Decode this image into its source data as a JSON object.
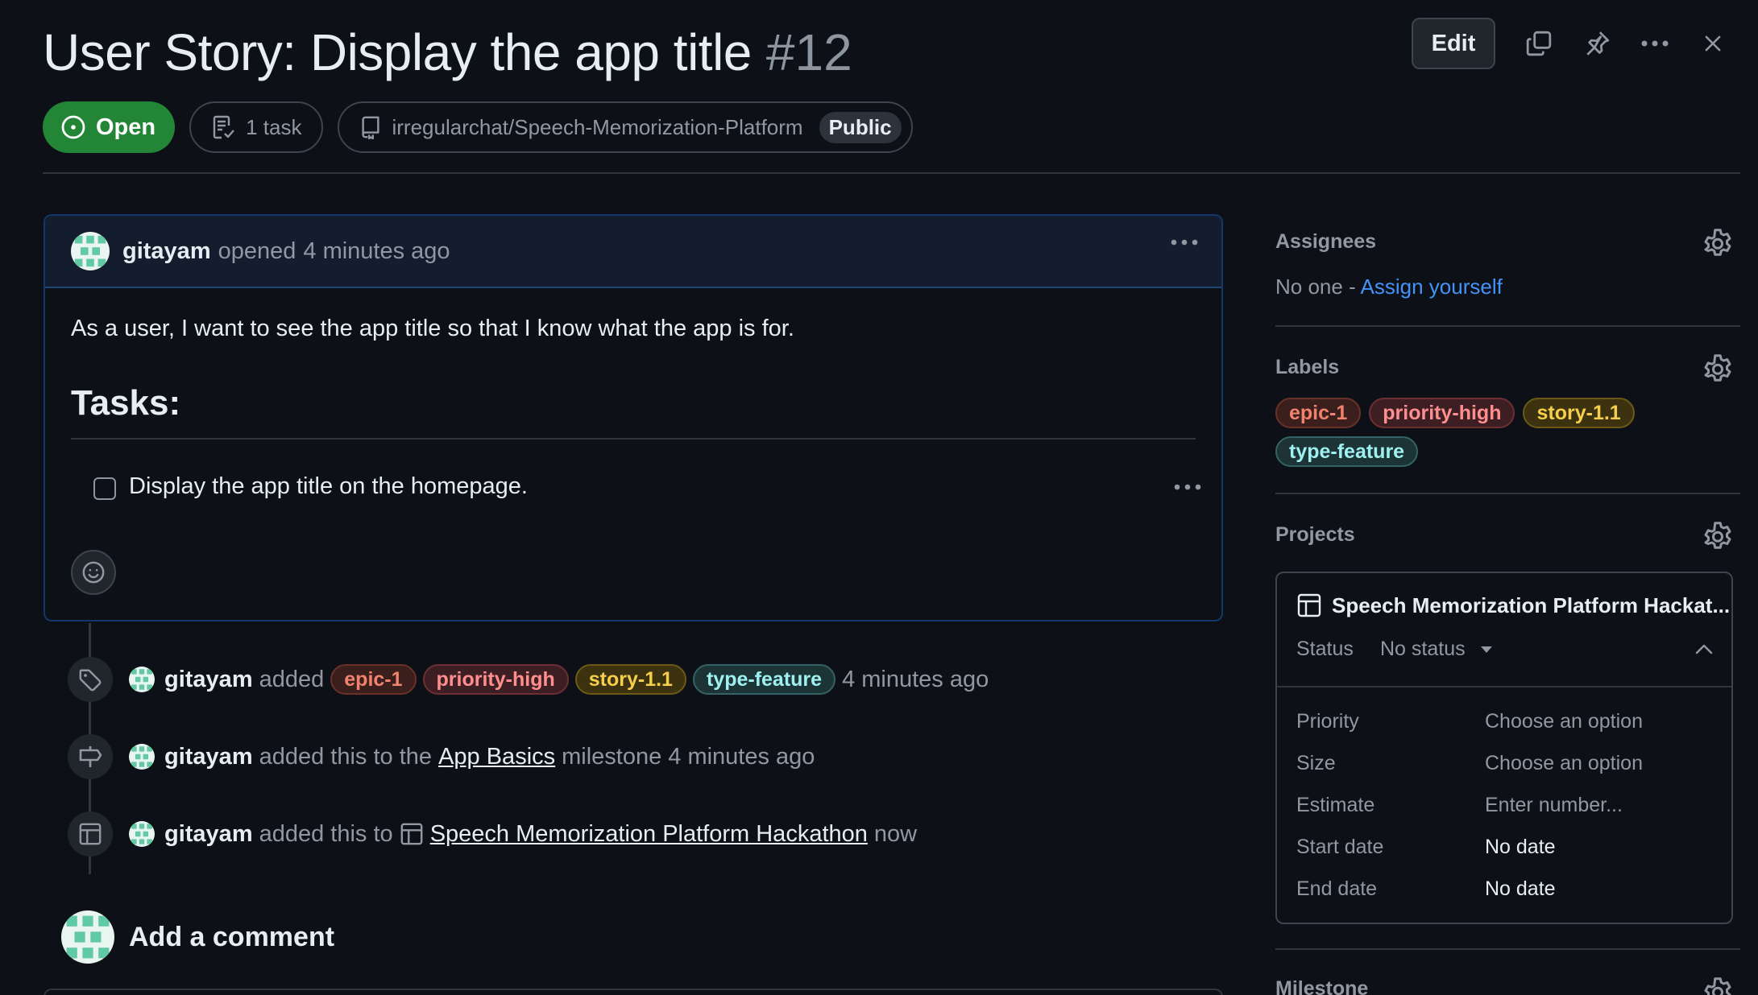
{
  "issue": {
    "title": "User Story: Display the app title",
    "number": "#12",
    "state": "Open",
    "tasks": "1 task",
    "repo": "irregularchat/Speech-Memorization-Platform",
    "visibility": "Public"
  },
  "header_actions": {
    "edit_label": "Edit",
    "icons": [
      "copy-icon",
      "pin-icon",
      "kebab-horizontal-icon",
      "close-icon"
    ]
  },
  "body": {
    "author": "gitayam",
    "opened_text": "opened",
    "time": "4 minutes ago",
    "text": "As a user, I want to see the app title so that I know what the app is for.",
    "tasks_heading": "Tasks:",
    "task_item": "Display the app title on the homepage."
  },
  "labels": [
    {
      "name": "epic-1",
      "color": "#f0826e"
    },
    {
      "name": "priority-high",
      "color": "#ff8f8f"
    },
    {
      "name": "story-1.1",
      "color": "#f5cf4a"
    },
    {
      "name": "type-feature",
      "color": "#9ff0f0"
    }
  ],
  "timeline": {
    "labels_event": {
      "user": "gitayam",
      "verb": "added",
      "time": "4 minutes ago"
    },
    "milestone_event": {
      "user": "gitayam",
      "verb": "added this to the",
      "milestone": "App Basics",
      "suffix": "milestone",
      "time": "4 minutes ago"
    },
    "project_event": {
      "user": "gitayam",
      "verb": "added this to",
      "project": "Speech Memorization Platform Hackathon",
      "time": "now"
    }
  },
  "comment": {
    "heading": "Add a comment"
  },
  "sidebar": {
    "assignees": {
      "label": "Assignees",
      "none": "No one -",
      "assign_link": "Assign yourself"
    },
    "labels_heading": "Labels",
    "projects": {
      "label": "Projects",
      "name": "Speech Memorization Platform Hackat...",
      "status_label": "Status",
      "status_value": "No status",
      "fields": [
        {
          "key": "Priority",
          "value": "Choose an option",
          "placeholder": true
        },
        {
          "key": "Size",
          "value": "Choose an option",
          "placeholder": true
        },
        {
          "key": "Estimate",
          "value": "Enter number...",
          "placeholder": true
        },
        {
          "key": "Start date",
          "value": "No date",
          "placeholder": false
        },
        {
          "key": "End date",
          "value": "No date",
          "placeholder": false
        }
      ]
    },
    "milestone_label": "Milestone"
  },
  "colors": {
    "background": "#0d1117",
    "open_green": "#238636",
    "link_blue": "#4493f8"
  }
}
